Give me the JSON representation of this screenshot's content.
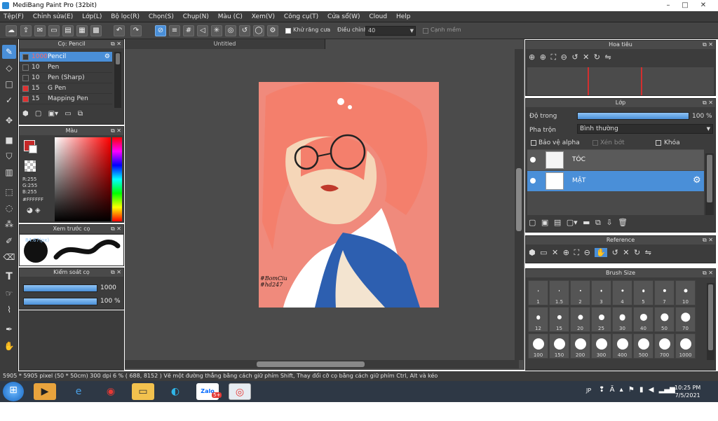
{
  "window": {
    "title": "MediBang Paint Pro (32bit)"
  },
  "menu": [
    "Tệp(F)",
    "Chỉnh sửa(E)",
    "Lớp(L)",
    "Bộ lọc(R)",
    "Chọn(S)",
    "Chụp(N)",
    "Màu (C)",
    "Xem(V)",
    "Công cụ(T)",
    "Cửa sổ(W)",
    "Cloud",
    "Help"
  ],
  "toolbar": {
    "antialias_label": "Khử răng cưa",
    "correction_label": "Điều chỉnh",
    "correction_value": "40",
    "edge_label": "Cạnh mềm"
  },
  "brush_panel": {
    "title": "Cọ: Pencil",
    "items": [
      {
        "size": "1000",
        "name": "Pencil",
        "color": "#3a3a3a",
        "selected": true
      },
      {
        "size": "10",
        "name": "Pen",
        "color": "#3a3a3a",
        "selected": false
      },
      {
        "size": "10",
        "name": "Pen (Sharp)",
        "color": "#3a3a3a",
        "selected": false
      },
      {
        "size": "15",
        "name": "G Pen",
        "color": "#e03030",
        "selected": false
      },
      {
        "size": "15",
        "name": "Mapping Pen",
        "color": "#e03030",
        "selected": false
      }
    ]
  },
  "color_panel": {
    "title": "Màu",
    "r": "R:255",
    "g": "G:255",
    "b": "B:255",
    "hex": "#FFFFFF"
  },
  "preview_panel": {
    "title": "Xem trước cọ",
    "size": "84.67(px)"
  },
  "control_panel": {
    "title": "Kiểm soát cọ",
    "size_value": "1000",
    "size_fraction": 1.0,
    "opacity_value": "100 %",
    "opacity_fraction": 1.0
  },
  "canvas": {
    "tab": "Untitled",
    "signature_line1": "#BomCiu",
    "signature_line2": "#hd247"
  },
  "navigator": {
    "title": "Hoa tiêu"
  },
  "layers": {
    "title": "Lớp",
    "opacity_label": "Độ trong",
    "opacity_value": "100 %",
    "opacity_fraction": 1.0,
    "blend_label": "Pha trộn",
    "blend_value": "Bình thường",
    "protect_alpha": "Bảo vệ alpha",
    "clipping": "Xén bớt",
    "lock": "Khóa",
    "items": [
      {
        "name": "TÓC",
        "selected": false
      },
      {
        "name": "MẶT",
        "selected": true
      }
    ]
  },
  "reference": {
    "title": "Reference"
  },
  "brush_size": {
    "title": "Brush Size",
    "sizes": [
      "1",
      "1.5",
      "2",
      "3",
      "4",
      "5",
      "7",
      "10",
      "12",
      "15",
      "20",
      "25",
      "30",
      "40",
      "50",
      "70",
      "100",
      "150",
      "200",
      "300",
      "400",
      "500",
      "700",
      "1000"
    ]
  },
  "status": {
    "dimensions": "5905 * 5905 pixel",
    "physical": "(50 * 50cm)",
    "dpi": "300 dpi",
    "zoom": "6 %",
    "coords": "( 688, 8152 )",
    "hint": "Vẽ một đường thẳng bằng cách giữ phím Shift, Thay đổi cỡ cọ bằng cách giữ phím Ctrl, Alt và kéo"
  },
  "taskbar": {
    "lang": "JP",
    "time": "10:25 PM",
    "date": "7/5/2021",
    "zalo_label": "Zalo",
    "zalo_badge": "5+"
  },
  "colors": {
    "accent": "#4a8fd8",
    "panel": "#3c3c3c",
    "canvas_bg": "#4b4b4b"
  }
}
